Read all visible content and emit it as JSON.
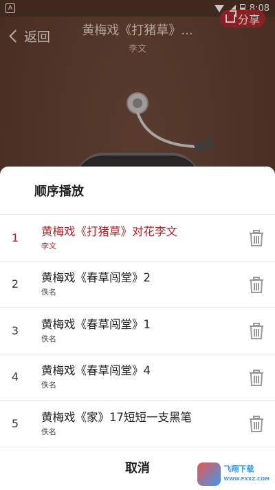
{
  "status_bar": {
    "time": "8:08",
    "left_icon_label": "A"
  },
  "player": {
    "back_label": "返回",
    "title": "黄梅戏《打猪草》...",
    "subtitle": "李文",
    "share_label": "分享"
  },
  "playlist": {
    "mode_label": "顺序播放",
    "items": [
      {
        "index": "1",
        "title": "黄梅戏《打猪草》对花李文",
        "artist": "李文",
        "active": true
      },
      {
        "index": "2",
        "title": "黄梅戏《春草闯堂》2",
        "artist": "佚名",
        "active": false
      },
      {
        "index": "3",
        "title": "黄梅戏《春草闯堂》1",
        "artist": "佚名",
        "active": false
      },
      {
        "index": "4",
        "title": "黄梅戏《春草闯堂》4",
        "artist": "佚名",
        "active": false
      },
      {
        "index": "5",
        "title": "黄梅戏《家》17短短一支黑笔",
        "artist": "佚名",
        "active": false
      }
    ],
    "cancel_label": "取消"
  },
  "watermark": {
    "text_top": "飞翔下载",
    "text_bottom": "WWW.FXXZ.COM"
  },
  "colors": {
    "accent": "#b3262b",
    "background": "#5a3c30"
  }
}
